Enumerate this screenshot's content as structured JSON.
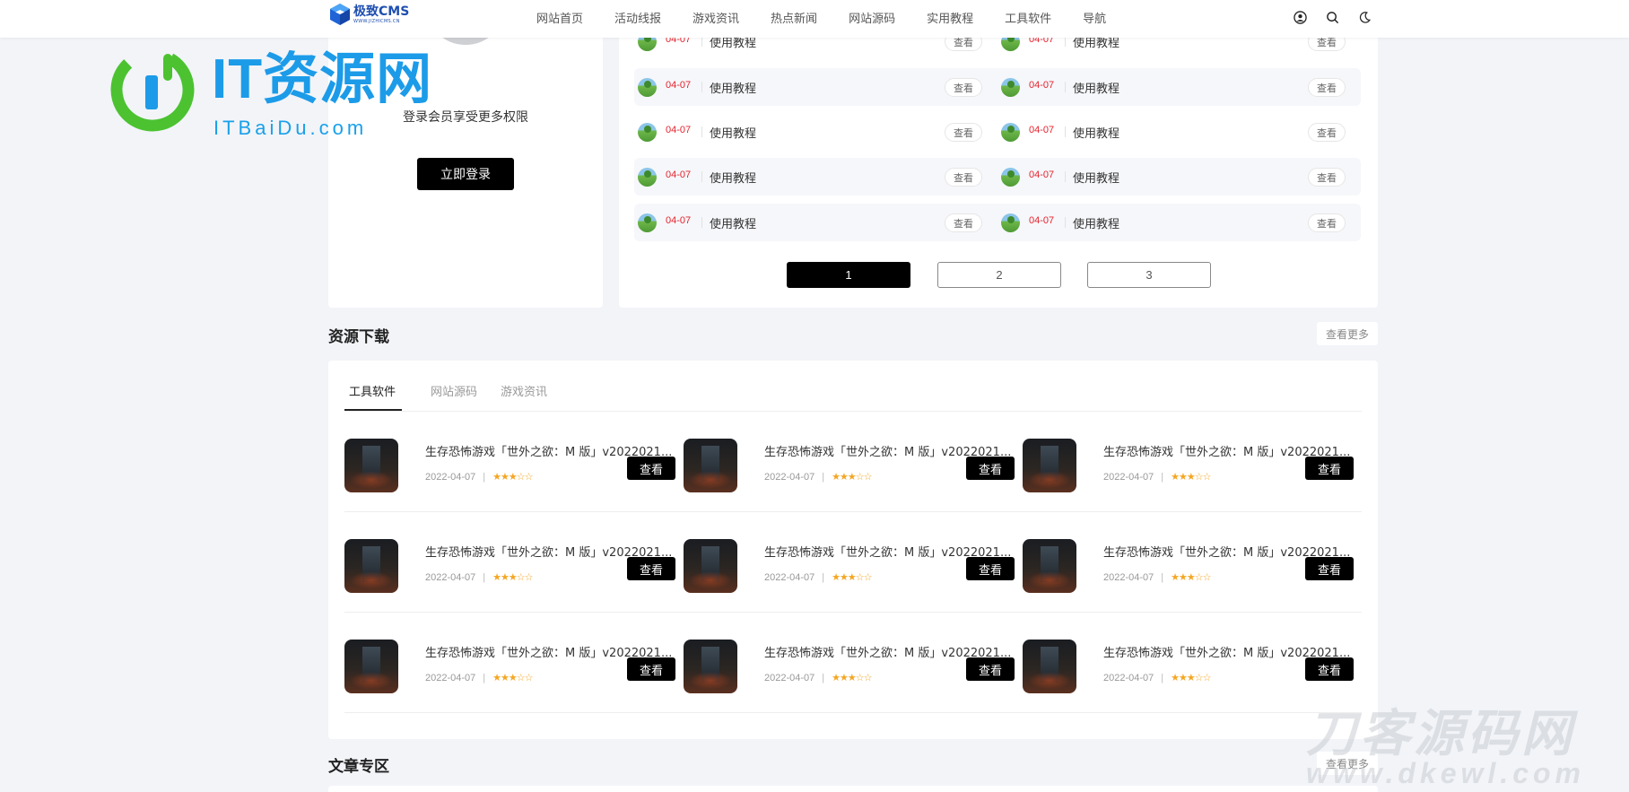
{
  "nav": {
    "logo_name": "极致CMS",
    "logo_url": "WWW.JIZHICMS.CN",
    "items": [
      "网站首页",
      "活动线报",
      "游戏资讯",
      "热点新闻",
      "网站源码",
      "实用教程",
      "工具软件",
      "导航"
    ],
    "icons": [
      "user-icon",
      "search-icon",
      "moon-icon"
    ]
  },
  "watermarks": {
    "it_title": "IT资源网",
    "it_sub": "ITBaiDu.com",
    "dk_title": "刀客源码网",
    "dk_sub": "www.dkewl.com"
  },
  "login": {
    "tip": "登录会员享受更多权限",
    "button": "立即登录"
  },
  "tutorial_list": {
    "rows": [
      {
        "left": {
          "date": "04-07",
          "title": "使用教程",
          "view": "查看"
        },
        "right": {
          "date": "04-07",
          "title": "使用教程",
          "view": "查看"
        }
      },
      {
        "left": {
          "date": "04-07",
          "title": "使用教程",
          "view": "查看"
        },
        "right": {
          "date": "04-07",
          "title": "使用教程",
          "view": "查看"
        }
      },
      {
        "left": {
          "date": "04-07",
          "title": "使用教程",
          "view": "查看"
        },
        "right": {
          "date": "04-07",
          "title": "使用教程",
          "view": "查看"
        }
      },
      {
        "left": {
          "date": "04-07",
          "title": "使用教程",
          "view": "查看"
        },
        "right": {
          "date": "04-07",
          "title": "使用教程",
          "view": "查看"
        }
      },
      {
        "left": {
          "date": "04-07",
          "title": "使用教程",
          "view": "查看"
        },
        "right": {
          "date": "04-07",
          "title": "使用教程",
          "view": "查看"
        }
      }
    ],
    "pages": [
      "1",
      "2",
      "3"
    ],
    "current_page": "1"
  },
  "resources": {
    "title": "资源下载",
    "more": "查看更多",
    "tabs": [
      "工具软件",
      "网站源码",
      "游戏资讯"
    ],
    "active_tab": "工具软件",
    "rows": [
      [
        {
          "title": "生存恐怖游戏「世外之欲：M 版」v2022021...",
          "date": "2022-04-07",
          "stars": "★★★☆☆",
          "rating": 3,
          "button": "查看"
        },
        {
          "title": "生存恐怖游戏「世外之欲：M 版」v2022021...",
          "date": "2022-04-07",
          "stars": "★★★☆☆",
          "rating": 3,
          "button": "查看"
        },
        {
          "title": "生存恐怖游戏「世外之欲：M 版」v2022021...",
          "date": "2022-04-07",
          "stars": "★★★☆☆",
          "rating": 3,
          "button": "查看"
        }
      ],
      [
        {
          "title": "生存恐怖游戏「世外之欲：M 版」v2022021...",
          "date": "2022-04-07",
          "stars": "★★★☆☆",
          "rating": 3,
          "button": "查看"
        },
        {
          "title": "生存恐怖游戏「世外之欲：M 版」v2022021...",
          "date": "2022-04-07",
          "stars": "★★★☆☆",
          "rating": 3,
          "button": "查看"
        },
        {
          "title": "生存恐怖游戏「世外之欲：M 版」v2022021...",
          "date": "2022-04-07",
          "stars": "★★★☆☆",
          "rating": 3,
          "button": "查看"
        }
      ],
      [
        {
          "title": "生存恐怖游戏「世外之欲：M 版」v2022021...",
          "date": "2022-04-07",
          "stars": "★★★☆☆",
          "rating": 3,
          "button": "查看"
        },
        {
          "title": "生存恐怖游戏「世外之欲：M 版」v2022021...",
          "date": "2022-04-07",
          "stars": "★★★☆☆",
          "rating": 3,
          "button": "查看"
        },
        {
          "title": "生存恐怖游戏「世外之欲：M 版」v2022021...",
          "date": "2022-04-07",
          "stars": "★★★☆☆",
          "rating": 3,
          "button": "查看"
        }
      ]
    ]
  },
  "articles": {
    "title": "文章专区",
    "more": "查看更多"
  },
  "colors": {
    "accent": "#000000",
    "date_red": "#e5232e",
    "star": "#f5a623",
    "page_bg": "#f2f4f8",
    "logo_blue": "#1f4fb0"
  }
}
